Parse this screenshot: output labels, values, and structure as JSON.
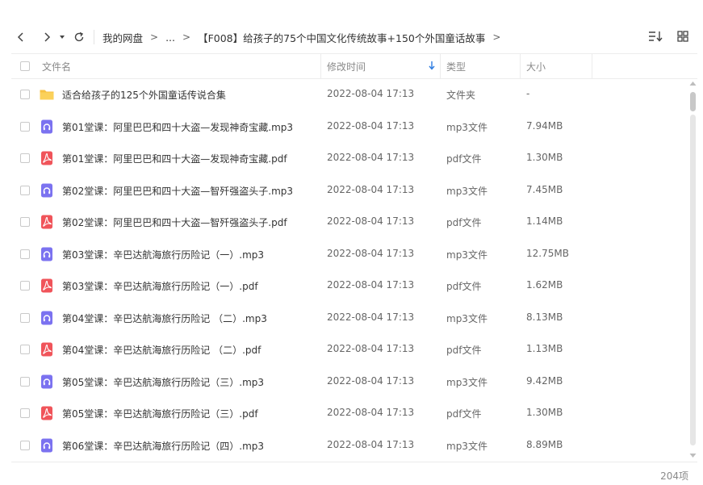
{
  "toolbar": {
    "breadcrumb": [
      "我的网盘",
      "...",
      "【F008】给孩子的75个中国文化传统故事+150个外国童话故事"
    ],
    "separator": ">"
  },
  "columns": {
    "name": "文件名",
    "modified": "修改时间",
    "type": "类型",
    "size": "大小"
  },
  "files": [
    {
      "name": "适合给孩子的125个外国童话传说合集",
      "date": "2022-08-04 17:13",
      "type": "文件夹",
      "size": "-",
      "icon": "folder-icon"
    },
    {
      "name": "第01堂课：阿里巴巴和四十大盗—发现神奇宝藏.mp3",
      "date": "2022-08-04 17:13",
      "type": "mp3文件",
      "size": "7.94MB",
      "icon": "audio-file-icon"
    },
    {
      "name": "第01堂课：阿里巴巴和四十大盗—发现神奇宝藏.pdf",
      "date": "2022-08-04 17:13",
      "type": "pdf文件",
      "size": "1.30MB",
      "icon": "pdf-file-icon"
    },
    {
      "name": "第02堂课：阿里巴巴和四十大盗—智歼强盗头子.mp3",
      "date": "2022-08-04 17:13",
      "type": "mp3文件",
      "size": "7.45MB",
      "icon": "audio-file-icon"
    },
    {
      "name": "第02堂课：阿里巴巴和四十大盗—智歼强盗头子.pdf",
      "date": "2022-08-04 17:13",
      "type": "pdf文件",
      "size": "1.14MB",
      "icon": "pdf-file-icon"
    },
    {
      "name": "第03堂课：辛巴达航海旅行历险记（一）.mp3",
      "date": "2022-08-04 17:13",
      "type": "mp3文件",
      "size": "12.75MB",
      "icon": "audio-file-icon"
    },
    {
      "name": "第03堂课：辛巴达航海旅行历险记（一）.pdf",
      "date": "2022-08-04 17:13",
      "type": "pdf文件",
      "size": "1.62MB",
      "icon": "pdf-file-icon"
    },
    {
      "name": "第04堂课：辛巴达航海旅行历险记 （二）.mp3",
      "date": "2022-08-04 17:13",
      "type": "mp3文件",
      "size": "8.13MB",
      "icon": "audio-file-icon"
    },
    {
      "name": "第04堂课：辛巴达航海旅行历险记 （二）.pdf",
      "date": "2022-08-04 17:13",
      "type": "pdf文件",
      "size": "1.13MB",
      "icon": "pdf-file-icon"
    },
    {
      "name": "第05堂课：辛巴达航海旅行历险记（三）.mp3",
      "date": "2022-08-04 17:13",
      "type": "mp3文件",
      "size": "9.42MB",
      "icon": "audio-file-icon"
    },
    {
      "name": "第05堂课：辛巴达航海旅行历险记（三）.pdf",
      "date": "2022-08-04 17:13",
      "type": "pdf文件",
      "size": "1.30MB",
      "icon": "pdf-file-icon"
    },
    {
      "name": "第06堂课：辛巴达航海旅行历险记（四）.mp3",
      "date": "2022-08-04 17:13",
      "type": "mp3文件",
      "size": "8.89MB",
      "icon": "audio-file-icon"
    }
  ],
  "footer": {
    "count": "204项"
  },
  "colors": {
    "accent": "#2f7de1",
    "folder": "#f7c244",
    "audio": "#7b72f0",
    "pdf": "#f0545a"
  }
}
